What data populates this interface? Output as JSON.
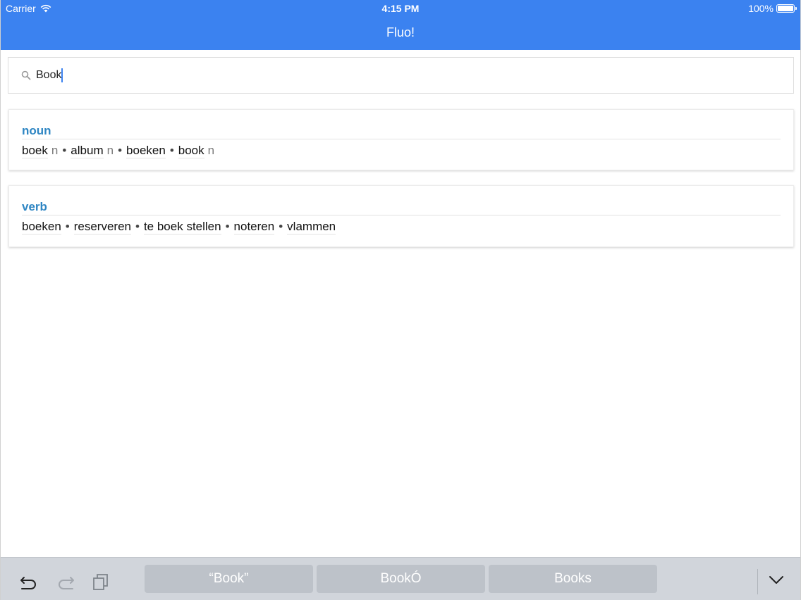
{
  "status_bar": {
    "carrier": "Carrier",
    "time": "4:15 PM",
    "battery": "100%"
  },
  "nav": {
    "title": "Fluo!"
  },
  "search": {
    "value": "Book",
    "icon": "search-icon"
  },
  "results": [
    {
      "pos": "noun",
      "words": [
        {
          "text": "boek",
          "gender": "n"
        },
        {
          "text": "album",
          "gender": "n"
        },
        {
          "text": "boeken",
          "gender": ""
        },
        {
          "text": "book",
          "gender": "n"
        }
      ]
    },
    {
      "pos": "verb",
      "words": [
        {
          "text": "boeken",
          "gender": ""
        },
        {
          "text": "reserveren",
          "gender": ""
        },
        {
          "text": "te boek stellen",
          "gender": ""
        },
        {
          "text": "noteren",
          "gender": ""
        },
        {
          "text": "vlammen",
          "gender": ""
        }
      ]
    }
  ],
  "separator": "•",
  "keyboard_bar": {
    "suggestions": [
      "“Book”",
      "BookÓ",
      "Books"
    ],
    "tools": [
      "undo-icon",
      "redo-icon",
      "paste-icon"
    ],
    "dismiss_icon": "keyboard-dismiss-chevron-icon"
  },
  "colors": {
    "nav_bar": "#3b82f0",
    "part_of_speech": "#2f86c3",
    "keyboard_bar": "#d1d5db"
  }
}
